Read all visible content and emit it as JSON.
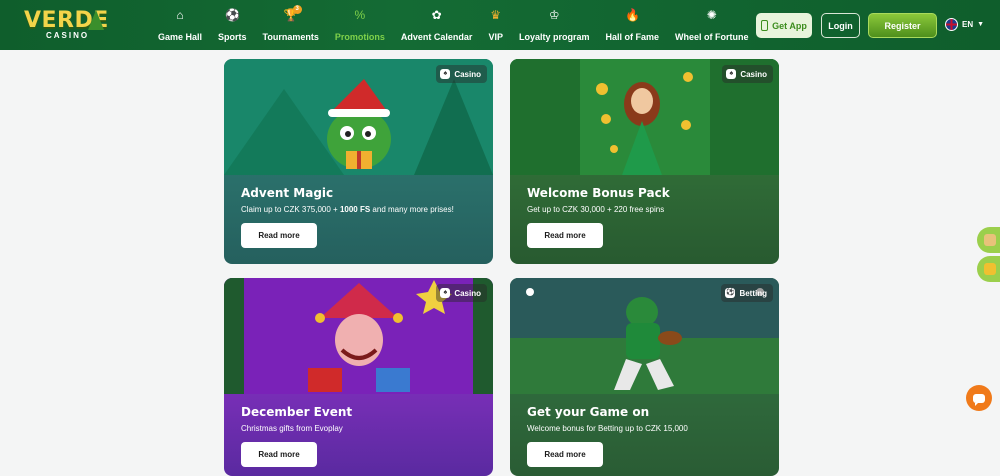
{
  "brand": {
    "name": "VERDE",
    "sub": "CASINO"
  },
  "nav": [
    {
      "label": "Game Hall",
      "icon": "home-icon",
      "glyph": "⌂",
      "active": false
    },
    {
      "label": "Sports",
      "icon": "soccer-ball-icon",
      "glyph": "⚽",
      "active": false
    },
    {
      "label": "Tournaments",
      "icon": "trophy-icon",
      "glyph": "🏆",
      "active": false,
      "badge": "3"
    },
    {
      "label": "Promotions",
      "icon": "percent-icon",
      "glyph": "%",
      "active": true
    },
    {
      "label": "Advent Calendar",
      "icon": "mistletoe-icon",
      "glyph": "✿",
      "active": false
    },
    {
      "label": "VIP",
      "icon": "crown-icon",
      "glyph": "♛",
      "active": false
    },
    {
      "label": "Loyalty program",
      "icon": "crown-outline-icon",
      "glyph": "♔",
      "active": false
    },
    {
      "label": "Hall of Fame",
      "icon": "flame-icon",
      "glyph": "🔥",
      "active": false
    },
    {
      "label": "Wheel of Fortune",
      "icon": "wheel-icon",
      "glyph": "✺",
      "active": false
    }
  ],
  "header": {
    "get_app": "Get App",
    "login": "Login",
    "register": "Register",
    "lang": "EN"
  },
  "cards": [
    {
      "title": "Advent Magic",
      "desc_pre": "Claim up to CZK 375,000 + ",
      "desc_bold": "1000 FS",
      "desc_post": " and many more prises!",
      "button": "Read more",
      "tag": "Casino",
      "tag_icon": "casino-icon",
      "colors": {
        "top": "#1f9a6a",
        "bottom": "#1f6e70"
      }
    },
    {
      "title": "Welcome Bonus Pack",
      "desc_pre": "Get up to CZK 30,000 + 220 free spins",
      "desc_bold": "",
      "desc_post": "",
      "button": "Read more",
      "tag": "Casino",
      "tag_icon": "casino-icon",
      "colors": {
        "top": "#2b8a3a",
        "bottom": "#2a5a2e"
      }
    },
    {
      "title": "December Event",
      "desc_pre": "Christmas gifts from Evoplay",
      "desc_bold": "",
      "desc_post": "",
      "button": "Read more",
      "tag": "Casino",
      "tag_icon": "casino-icon",
      "colors": {
        "top": "#8a2ad0",
        "bottom": "#5e2aa0"
      }
    },
    {
      "title": "Get your Game on",
      "desc_pre": "Welcome bonus for Betting up to CZK 15,000",
      "desc_bold": "",
      "desc_post": "",
      "button": "Read more",
      "tag": "Betting",
      "tag_icon": "soccer-ball-icon",
      "colors": {
        "top": "#3a8a4a",
        "bottom": "#2a5a36"
      }
    }
  ]
}
